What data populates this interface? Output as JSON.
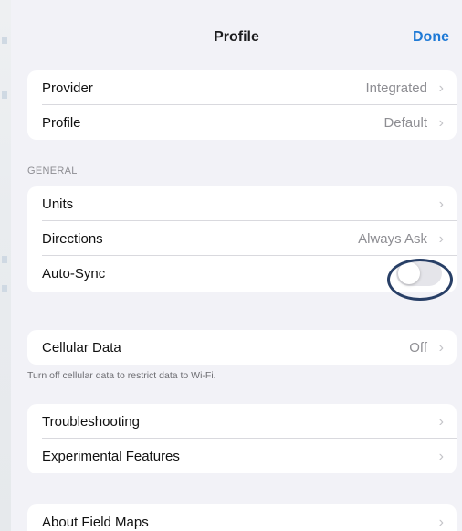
{
  "nav": {
    "title": "Profile",
    "done_label": "Done"
  },
  "group1": [
    {
      "label": "Provider",
      "value": "Integrated"
    },
    {
      "label": "Profile",
      "value": "Default"
    }
  ],
  "general": {
    "header": "GENERAL",
    "units_label": "Units",
    "directions_label": "Directions",
    "directions_value": "Always Ask",
    "autosync_label": "Auto-Sync",
    "autosync_on": false
  },
  "cellular": {
    "label": "Cellular Data",
    "value": "Off",
    "footer": "Turn off cellular data to restrict data to Wi-Fi."
  },
  "support": [
    {
      "label": "Troubleshooting"
    },
    {
      "label": "Experimental Features"
    }
  ],
  "about": {
    "label": "About Field Maps"
  },
  "icons": {
    "chevron": "›"
  },
  "colors": {
    "accent": "#1f7ad6",
    "highlight_ring": "#283f66",
    "background": "#f2f2f7"
  }
}
